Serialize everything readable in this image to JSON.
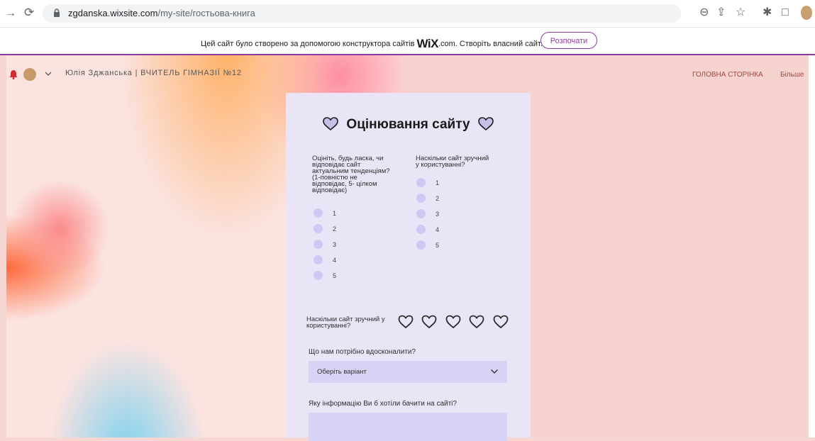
{
  "browser": {
    "url_domain": "zgdanska.wixsite.com",
    "url_path": "/my-site/гостьова-книга"
  },
  "banner": {
    "text_before": "Цей сайт було створено за допомогою конструктора сайтів",
    "brand": "WiX",
    "text_after": ".com. Створіть власний сайт.",
    "button": "Розпочати"
  },
  "site": {
    "header": "Юлія Зджанська | ВЧИТЕЛЬ ГІМНАЗІЇ №12",
    "nav": [
      "ГОЛОВНА СТОРІНКА",
      "Більше"
    ]
  },
  "form": {
    "title": "Оцінювання сайту",
    "q1": "Оцініть, будь ласка, чи\nвідповідає сайт\nактуальним тенденціям?\n(1-повністю не\nвідповідає, 5- цілком\nвідповідає)",
    "q1_options": [
      "1",
      "2",
      "3",
      "4",
      "5"
    ],
    "q2": "Наскільки сайт зручний\nу користуванні?",
    "q2_options": [
      "1",
      "2",
      "3",
      "4",
      "5"
    ],
    "q3": "Наскільки сайт зручний у користуванні?",
    "rating_max": 5,
    "improve_label": "Що нам потрібно вдосконалити?",
    "improve_placeholder": "Оберіть варіант",
    "info_label": "Яку інформацію Ви б хотіли бачити на сайті?"
  },
  "colors": {
    "banner_accent": "#8e3b9e",
    "card_bg": "#e9e5f7",
    "input_bg": "#d8d3f5",
    "radio": "#cfc8f3",
    "nav": "#a0473f"
  }
}
